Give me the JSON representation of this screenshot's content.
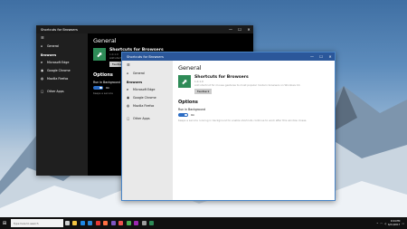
{
  "desktop": {
    "wallpaper": "snowy-mountains"
  },
  "dark_window": {
    "title": "Shortcuts for Browsers",
    "controls": {
      "minimize": "—",
      "maximize": "☐",
      "close": "✕"
    },
    "nav": [
      {
        "icon": "home-icon",
        "label": "General"
      },
      {
        "header": "Browsers"
      },
      {
        "icon": "edge-icon",
        "label": "Microsoft Edge"
      },
      {
        "icon": "chrome-icon",
        "label": "Google Chrome"
      },
      {
        "icon": "firefox-icon",
        "label": "Mozilla Firefox"
      },
      {
        "icon": "apps-icon",
        "label": "Other Apps"
      }
    ],
    "page_title": "General",
    "app_name": "Shortcuts for Browsers",
    "app_version": "1.0.1.0",
    "app_desc": "Add shortcut ke",
    "feedback": "Feedback",
    "options_header": "Options",
    "run_label": "Run in Background",
    "toggle_state": "On",
    "hint": "Keeps a service"
  },
  "light_window": {
    "title": "Shortcuts for Browsers",
    "controls": {
      "minimize": "—",
      "maximize": "☐",
      "close": "✕"
    },
    "nav": [
      {
        "icon": "home-icon",
        "label": "General"
      },
      {
        "header": "Browsers"
      },
      {
        "icon": "edge-icon",
        "label": "Microsoft Edge"
      },
      {
        "icon": "chrome-icon",
        "label": "Google Chrome"
      },
      {
        "icon": "firefox-icon",
        "label": "Mozilla Firefox"
      },
      {
        "icon": "apps-icon",
        "label": "Other Apps"
      }
    ],
    "page_title": "General",
    "app_name": "Shortcuts for Browsers",
    "app_version": "1.0.1.0",
    "app_desc": "Add shortcut for mouse gestures to most popular modern browsers on Windows 10.",
    "feedback": "Feedback",
    "options_header": "Options",
    "run_label": "Run in Background",
    "toggle_state": "On",
    "hint": "Keeps a service running in background to enable shortcuts continue to work after this window closes."
  },
  "taskbar": {
    "search_placeholder": "Type here to search",
    "apps": [
      {
        "name": "task-view-icon",
        "color": "#cfcfcf"
      },
      {
        "name": "file-explorer-icon",
        "color": "#f4c542"
      },
      {
        "name": "edge-icon",
        "color": "#1e88e5"
      },
      {
        "name": "store-icon",
        "color": "#2b88d8"
      },
      {
        "name": "chrome-icon",
        "color": "#e53935"
      },
      {
        "name": "firefox-icon",
        "color": "#ff7043"
      },
      {
        "name": "photos-icon",
        "color": "#7e57c2"
      },
      {
        "name": "media-icon",
        "color": "#ef5350"
      },
      {
        "name": "terminal-icon",
        "color": "#4caf50"
      },
      {
        "name": "vs-icon",
        "color": "#9c27b0"
      },
      {
        "name": "settings-icon",
        "color": "#9e9e9e"
      },
      {
        "name": "shortcuts-app-icon",
        "color": "#2e8b57"
      }
    ],
    "time": "9:44 PM",
    "date": "6/21/2017"
  }
}
